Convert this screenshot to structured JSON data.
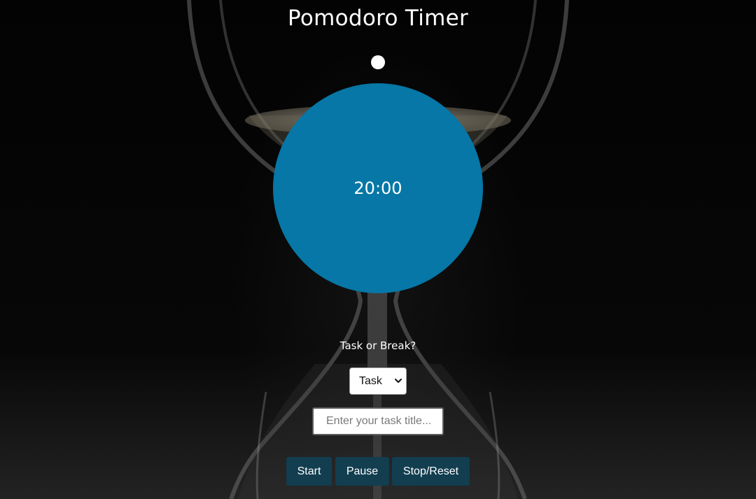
{
  "header": {
    "title": "Pomodoro Timer"
  },
  "timer": {
    "display": "20:00",
    "circle_color": "#0677a6"
  },
  "mode": {
    "label": "Task or Break?",
    "selected": "Task"
  },
  "task": {
    "placeholder": "Enter your task title...",
    "value": ""
  },
  "controls": {
    "start_label": "Start",
    "pause_label": "Pause",
    "stop_label": "Stop/Reset",
    "button_color": "#123e50"
  },
  "background": {
    "description_icon": "hourglass-image"
  }
}
